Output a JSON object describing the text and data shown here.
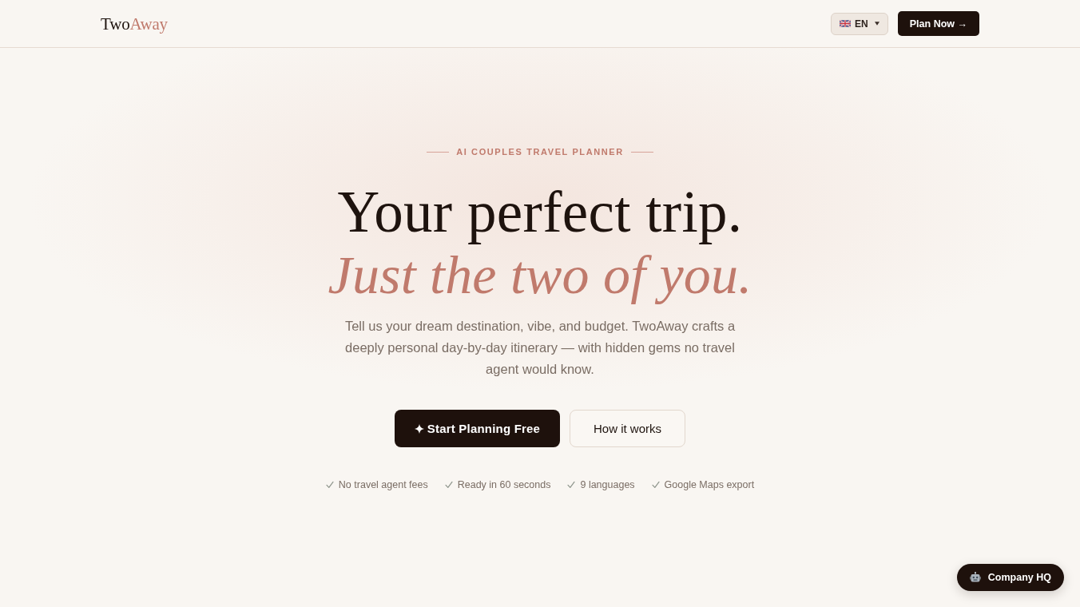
{
  "header": {
    "logo": {
      "text": "Two",
      "accent": "Away"
    },
    "language": {
      "code": "EN"
    },
    "cta": "Plan Now →"
  },
  "hero": {
    "eyebrow": "AI COUPLES TRAVEL PLANNER",
    "headline": "Your perfect trip.",
    "headline_accent": "Just the two of you.",
    "description": "Tell us your dream destination, vibe, and budget. TwoAway crafts a deeply personal day-by-day itinerary — with hidden gems no travel agent would know.",
    "buttons": [
      {
        "label": "Start Planning Free",
        "kind": "primary"
      },
      {
        "label": "How it works",
        "kind": "secondary"
      }
    ],
    "perks": [
      "No travel agent fees",
      "Ready in 60 seconds",
      "9 languages",
      "Google Maps export"
    ]
  },
  "floating_button": {
    "label": "Company HQ"
  }
}
